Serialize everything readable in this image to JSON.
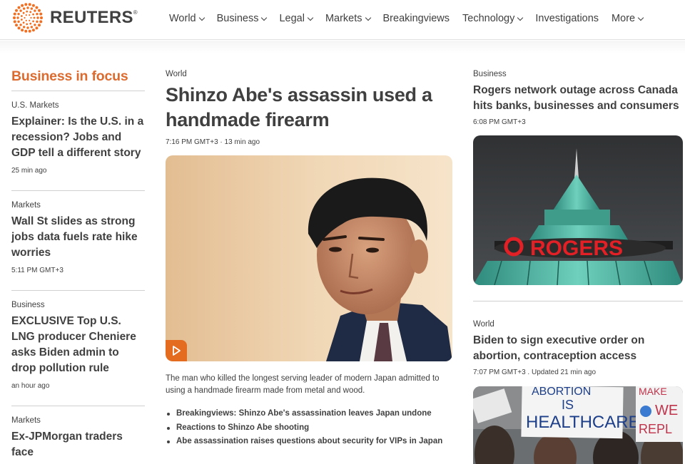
{
  "header": {
    "brand": "REUTERS",
    "brand_mark": "®",
    "nav": [
      {
        "label": "World",
        "dropdown": true
      },
      {
        "label": "Business",
        "dropdown": true
      },
      {
        "label": "Legal",
        "dropdown": true
      },
      {
        "label": "Markets",
        "dropdown": true
      },
      {
        "label": "Breakingviews",
        "dropdown": false
      },
      {
        "label": "Technology",
        "dropdown": true
      },
      {
        "label": "Investigations",
        "dropdown": false
      },
      {
        "label": "More",
        "dropdown": true
      }
    ]
  },
  "focus": {
    "title": "Business in focus",
    "accent": "#dc6b2f",
    "stories": [
      {
        "kicker": "U.S. Markets",
        "headline": "Explainer: Is the U.S. in a recession? Jobs and GDP tell a different story",
        "time": "25 min ago"
      },
      {
        "kicker": "Markets",
        "headline": "Wall St slides as strong jobs data fuels rate hike worries",
        "time": "5:11 PM GMT+3"
      },
      {
        "kicker": "Business",
        "headline": "EXCLUSIVE Top U.S. LNG producer Cheniere asks Biden admin to drop pollution rule",
        "time": "an hour ago"
      },
      {
        "kicker": "Markets",
        "headline": "Ex-JPMorgan traders face",
        "time": ""
      }
    ]
  },
  "lead": {
    "kicker": "World",
    "headline": "Shinzo Abe's assassin used a handmade firearm",
    "time": "7:16 PM GMT+3 · 13 min ago",
    "image_icon": "play-icon",
    "summary": "The man who killed the longest serving leader of modern Japan admitted to using a handmade firearm made from metal and wood.",
    "related": [
      "Breakingviews: Shinzo Abe's assassination leaves Japan undone",
      "Reactions to Shinzo Abe shooting",
      "Abe assassination raises questions about security for VIPs in Japan"
    ]
  },
  "right": {
    "story1": {
      "kicker": "Business",
      "headline": "Rogers network outage across Canada hits banks, businesses and consumers",
      "time": "6:08 PM GMT+3",
      "image_sign": "ROGERS"
    },
    "story2": {
      "kicker": "World",
      "headline": "Biden to sign executive order on abortion, contraception access",
      "time": "7:07 PM GMT+3 . Updated 21 min ago",
      "image_signs": [
        "ABORTION",
        "IS",
        "HEALTHCARE",
        "MAKE",
        "WE",
        "REPL"
      ]
    }
  }
}
